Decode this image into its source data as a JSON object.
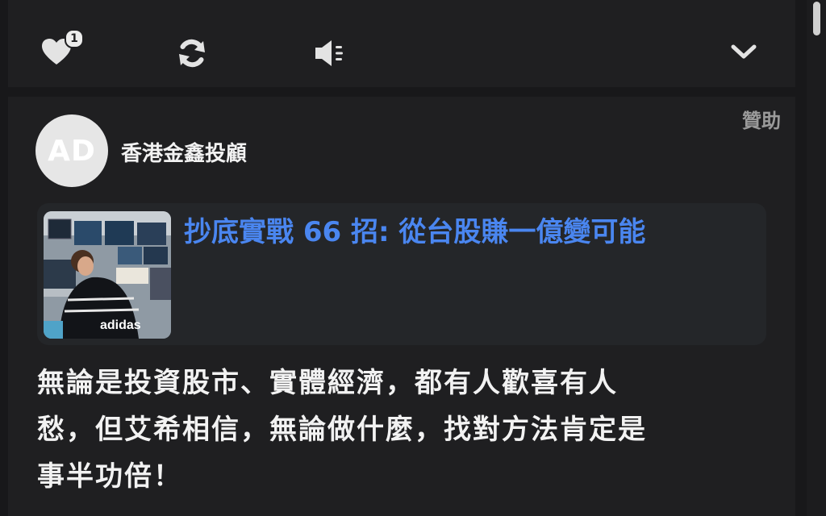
{
  "action_bar": {
    "like_count": "1",
    "like_icon": "heart-icon",
    "refresh_icon": "refresh-icon",
    "speaker_icon": "speaker-icon",
    "chevron_icon": "chevron-down-icon"
  },
  "post": {
    "sponsored_label": "贊助",
    "avatar_initials": "AD",
    "author": "香港金鑫投顧",
    "link": {
      "title": "抄底實戰 66 招: 從台股賺一億變可能",
      "thumbnail_icon": "trading-room-image"
    },
    "body_lines": [
      "無論是投資股市、實體經濟，都有人歡喜有人",
      "愁，但艾希相信，無論做什麼，找對方法肯定是",
      "事半功倍！"
    ]
  },
  "colors": {
    "background": "#18181a",
    "card": "#1f1f21",
    "link_title": "#4a86f0",
    "text": "#f2f2f2",
    "muted": "#9a9a9a"
  }
}
